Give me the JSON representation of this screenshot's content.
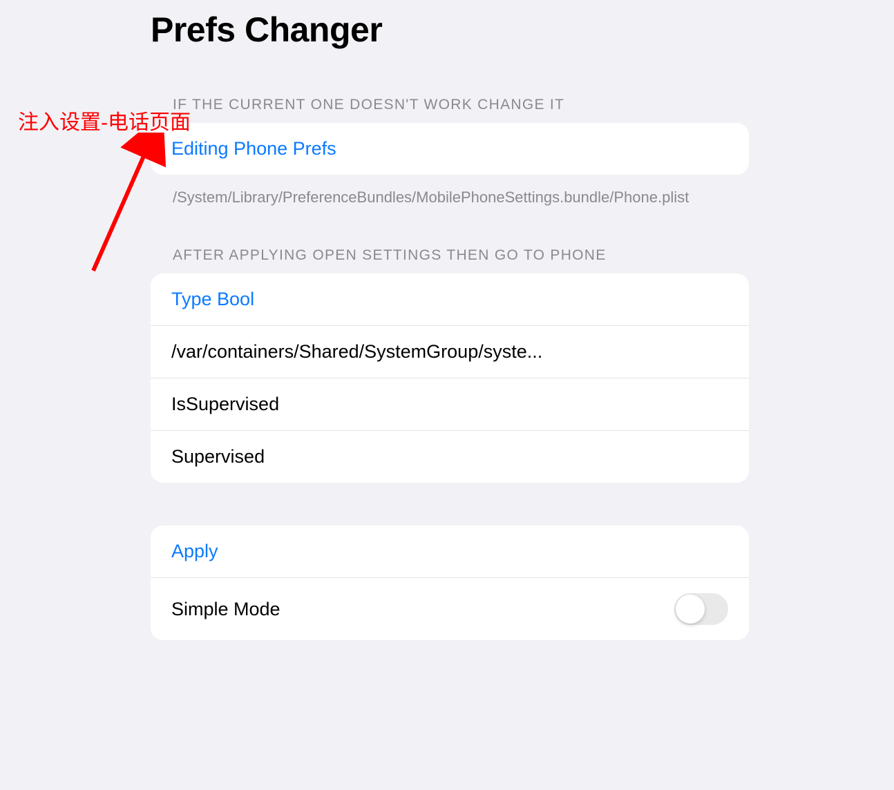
{
  "page": {
    "title": "Prefs Changer"
  },
  "annotation": {
    "text": "注入设置-电话页面"
  },
  "section1": {
    "header": "IF THE CURRENT ONE DOESN'T WORK CHANGE IT",
    "link_label": "Editing Phone Prefs",
    "footer": "/System/Library/PreferenceBundles/MobilePhoneSettings.bundle/Phone.plist"
  },
  "section2": {
    "header": "AFTER APPLYING OPEN SETTINGS THEN GO TO PHONE",
    "type_label": "Type Bool",
    "path_value": "/var/containers/Shared/SystemGroup/syste...",
    "key1": "IsSupervised",
    "key2": "Supervised"
  },
  "section3": {
    "apply_label": "Apply",
    "simple_mode_label": "Simple Mode",
    "simple_mode_on": false
  }
}
